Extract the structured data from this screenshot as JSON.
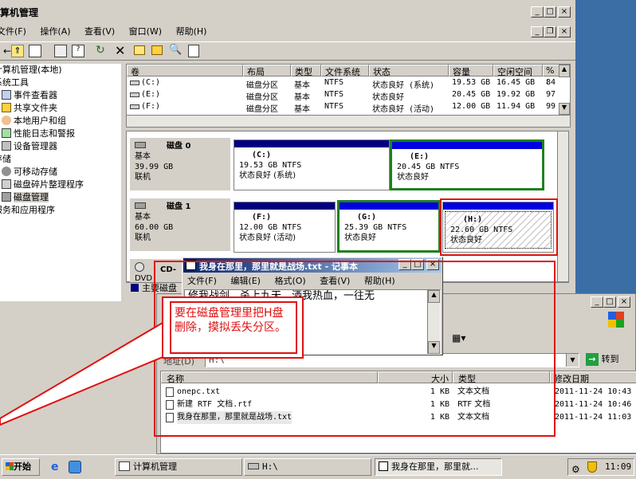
{
  "main": {
    "title": "机算机管理",
    "menu": [
      "文件(F)",
      "操作(A)",
      "查看(V)",
      "窗口(W)",
      "帮助(H)"
    ],
    "tree": [
      "计算机管理(本地)",
      "系统工具",
      "事件查看器",
      "共享文件夹",
      "本地用户和组",
      "性能日志和警报",
      "设备管理器",
      "存储",
      "可移动存储",
      "磁盘碎片整理程序",
      "磁盘管理",
      "服务和应用程序"
    ],
    "columns": [
      "卷",
      "布局",
      "类型",
      "文件系统",
      "状态",
      "容量",
      "空闲空间",
      "% :"
    ],
    "rows": [
      [
        "(C:)",
        "磁盘分区",
        "基本",
        "NTFS",
        "状态良好 (系统)",
        "19.53 GB",
        "16.45 GB",
        "84"
      ],
      [
        "(E:)",
        "磁盘分区",
        "基本",
        "NTFS",
        "状态良好",
        "20.45 GB",
        "19.92 GB",
        "97"
      ],
      [
        "(F:)",
        "磁盘分区",
        "基本",
        "NTFS",
        "状态良好 (活动)",
        "12.00 GB",
        "11.94 GB",
        "99"
      ]
    ],
    "disk0": {
      "name": "磁盘 0",
      "type": "基本",
      "size": "39.99 GB",
      "status": "联机"
    },
    "disk1": {
      "name": "磁盘 1",
      "type": "基本",
      "size": "60.00 GB",
      "status": "联机"
    },
    "vols": [
      {
        "letter": "(C:)",
        "size": "19.53 GB NTFS",
        "status": "状态良好 (系统)"
      },
      {
        "letter": "(E:)",
        "size": "20.45 GB NTFS",
        "status": "状态良好"
      },
      {
        "letter": "(F:)",
        "size": "12.00 GB NTFS",
        "status": "状态良好 (活动)"
      },
      {
        "letter": "(G:)",
        "size": "25.39 GB NTFS",
        "status": "状态良好"
      },
      {
        "letter": "(H:)",
        "size": "22.60 GB NTFS",
        "status": "状态良好"
      }
    ],
    "cd": "CD-",
    "cd_sub": "DVD",
    "legend": "主要磁盘"
  },
  "notepad": {
    "title": "我身在那里，那里就是战场.txt - 记事本",
    "menu": [
      "文件(F)",
      "编辑(E)",
      "格式(O)",
      "查看(V)",
      "帮助(H)"
    ],
    "content": "修我战剑，杀上九天，洒我热血，一往无"
  },
  "explorer": {
    "address_label": "地址(D)",
    "address_value": "H:\\",
    "go": "转到",
    "columns": [
      "名称",
      "大小",
      "类型",
      "修改日期"
    ],
    "files": [
      {
        "name": "onepc.txt",
        "size": "1 KB",
        "type": "文本文档",
        "date": "2011-11-24 10:43"
      },
      {
        "name": "新建 RTF 文档.rtf",
        "size": "1 KB",
        "type": "RTF 文档",
        "date": "2011-11-24 10:46"
      },
      {
        "name": "我身在那里，那里就是战场.txt",
        "size": "1 KB",
        "type": "文本文档",
        "date": "2011-11-24 11:03"
      }
    ]
  },
  "callout": "要在磁盘管理里把H盘删除，摸拟丢失分区。",
  "taskbar": {
    "start": "开始",
    "items": [
      "计算机管理",
      "H:\\",
      "我身在那里，那里就..."
    ],
    "clock": "11:09"
  },
  "colors": {
    "annotation": "#e01010",
    "titlebar": "#0a246a",
    "desktop": "#3a6ea5"
  }
}
